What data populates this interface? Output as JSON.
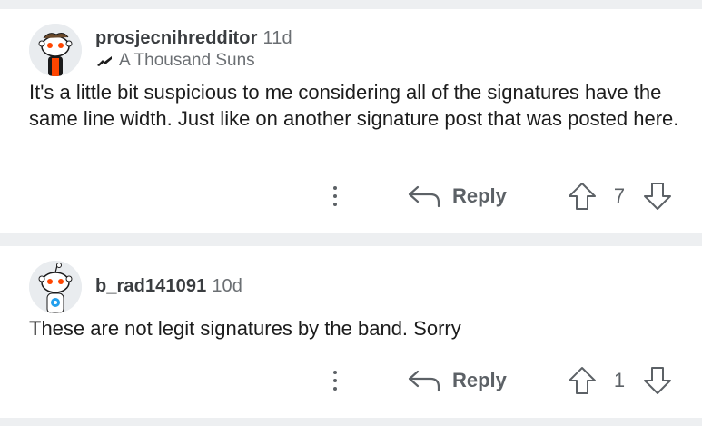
{
  "comments": [
    {
      "username": "prosjecnihredditor",
      "age": "11d",
      "flair": "A Thousand Suns",
      "body": "It's a little bit suspicious to me considering all of the signatures have the same line width. Just like on another signature post that was posted here.",
      "reply_label": "Reply",
      "score": "7"
    },
    {
      "username": "b_rad141091",
      "age": "10d",
      "body": "These are not legit signatures by the band. Sorry",
      "reply_label": "Reply",
      "score": "1"
    }
  ],
  "icons": {
    "more": "more-options-icon",
    "reply": "reply-arrow-icon",
    "upvote": "upvote-arrow-icon",
    "downvote": "downvote-arrow-icon",
    "avatar": "snoo-avatar-icon",
    "flair": "flair-icon"
  },
  "colors": {
    "background": "#edeff1",
    "card": "#ffffff",
    "text": "#1c1c1c",
    "muted": "#5c6166",
    "snoo_accent": "#ff4500"
  }
}
